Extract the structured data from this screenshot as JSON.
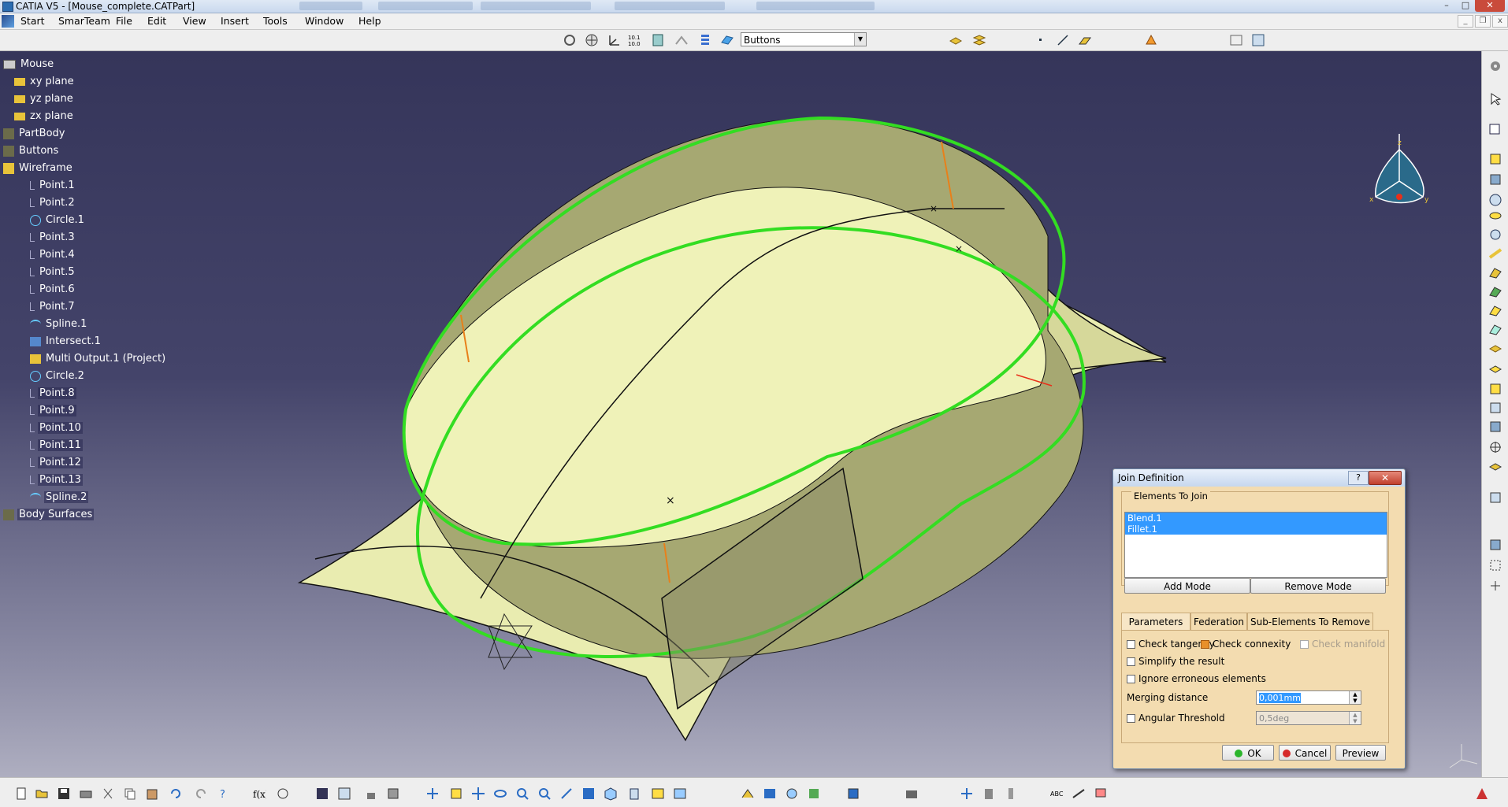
{
  "window": {
    "title": "CATIA V5 - [Mouse_complete.CATPart]",
    "minimize": "–",
    "maximize": "□",
    "close": "✕"
  },
  "menu": [
    "Start",
    "SmarTeam",
    "File",
    "Edit",
    "View",
    "Insert",
    "Tools",
    "Window",
    "Help"
  ],
  "toolbar": {
    "combo_value": "Buttons",
    "icons": [
      "freestyle-icon",
      "pan-icon",
      "axis-icon",
      "measure-icon",
      "layer-icon",
      "sketch-icon",
      "list-icon",
      "plane-icon",
      "combo",
      "extrude-icon",
      "join-icon",
      "point-icon",
      "line-icon",
      "plane2-icon",
      "healing-icon",
      "table-icon",
      "grid-icon"
    ]
  },
  "tree": {
    "root": "Mouse",
    "items": [
      {
        "label": "xy plane",
        "icon": "plane-icon"
      },
      {
        "label": "yz plane",
        "icon": "plane-icon"
      },
      {
        "label": "zx plane",
        "icon": "plane-icon"
      },
      {
        "label": "PartBody",
        "icon": "body-icon"
      },
      {
        "label": "Buttons",
        "icon": "body-icon"
      },
      {
        "label": "Wireframe",
        "icon": "geometric-set-icon"
      },
      {
        "label": "Point.1",
        "icon": "point-icon"
      },
      {
        "label": "Point.2",
        "icon": "point-icon"
      },
      {
        "label": "Circle.1",
        "icon": "circle-icon"
      },
      {
        "label": "Point.3",
        "icon": "point-icon"
      },
      {
        "label": "Point.4",
        "icon": "point-icon"
      },
      {
        "label": "Point.5",
        "icon": "point-icon"
      },
      {
        "label": "Point.6",
        "icon": "point-icon"
      },
      {
        "label": "Point.7",
        "icon": "point-icon"
      },
      {
        "label": "Spline.1",
        "icon": "spline-icon"
      },
      {
        "label": "Intersect.1",
        "icon": "intersect-icon"
      },
      {
        "label": "Multi Output.1 (Project)",
        "icon": "multi-output-icon"
      },
      {
        "label": "Circle.2",
        "icon": "circle-icon"
      },
      {
        "label": "Point.8",
        "icon": "point-icon"
      },
      {
        "label": "Point.9",
        "icon": "point-icon"
      },
      {
        "label": "Point.10",
        "icon": "point-icon"
      },
      {
        "label": "Point.11",
        "icon": "point-icon"
      },
      {
        "label": "Point.12",
        "icon": "point-icon"
      },
      {
        "label": "Point.13",
        "icon": "point-icon"
      },
      {
        "label": "Spline.2",
        "icon": "spline-icon"
      },
      {
        "label": "Body Surfaces",
        "icon": "body-icon"
      }
    ]
  },
  "dialog": {
    "title": "Join Definition",
    "help": "?",
    "close": "✕",
    "group_label": "Elements To Join",
    "elements": [
      "Blend.1",
      "Fillet.1"
    ],
    "add_mode": "Add Mode",
    "remove_mode": "Remove Mode",
    "tabs": [
      "Parameters",
      "Federation",
      "Sub-Elements To Remove"
    ],
    "check_tangency": "Check tangency",
    "check_connexity": "Check connexity",
    "check_manifold": "Check manifold",
    "simplify": "Simplify the result",
    "ignore": "Ignore erroneous elements",
    "merging_label": "Merging distance",
    "merging_value": "0,001mm",
    "angular_label": "Angular Threshold",
    "angular_value": "0,5deg",
    "ok": "OK",
    "cancel": "Cancel",
    "preview": "Preview"
  },
  "colors": {
    "viewport_top": "#35355a",
    "viewport_bottom": "#aeaec0",
    "surface": "#e9ecb0",
    "highlight": "#33dd22",
    "dialog_bg": "#f3dcb0",
    "selection": "#3399ff"
  },
  "compass_axes": {
    "x": "x",
    "y": "y",
    "z": "z"
  }
}
